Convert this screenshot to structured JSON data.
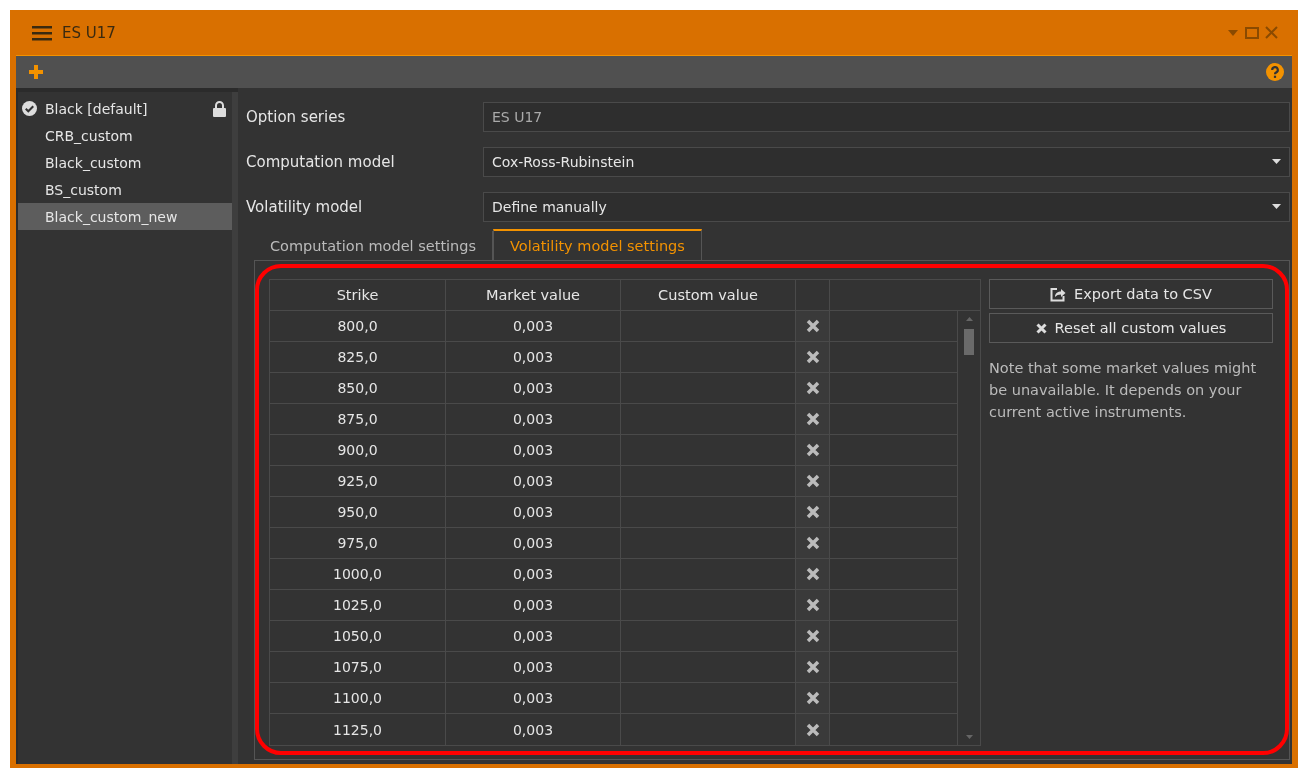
{
  "window": {
    "title": "ES U17"
  },
  "sidebar": {
    "items": [
      {
        "label": "Black [default]",
        "kind": "default",
        "selected": false
      },
      {
        "label": "CRB_custom",
        "kind": "custom",
        "selected": false
      },
      {
        "label": "Black_custom",
        "kind": "custom",
        "selected": false
      },
      {
        "label": "BS_custom",
        "kind": "custom",
        "selected": false
      },
      {
        "label": "Black_custom_new",
        "kind": "custom",
        "selected": true
      }
    ]
  },
  "form": [
    {
      "label": "Option series",
      "kind": "text",
      "value": "ES U17"
    },
    {
      "label": "Computation model",
      "kind": "dropdown",
      "value": "Cox-Ross-Rubinstein"
    },
    {
      "label": "Volatility model",
      "kind": "dropdown",
      "value": "Define manually"
    }
  ],
  "tabs": [
    {
      "label": "Computation model settings",
      "selected": false
    },
    {
      "label": "Volatility model settings",
      "selected": true
    }
  ],
  "table": {
    "columns": [
      "Strike",
      "Market value",
      "Custom value"
    ],
    "rows": [
      {
        "strike": "800,0",
        "market_value": "0,003"
      },
      {
        "strike": "825,0",
        "market_value": "0,003"
      },
      {
        "strike": "850,0",
        "market_value": "0,003"
      },
      {
        "strike": "875,0",
        "market_value": "0,003"
      },
      {
        "strike": "900,0",
        "market_value": "0,003"
      },
      {
        "strike": "925,0",
        "market_value": "0,003"
      },
      {
        "strike": "950,0",
        "market_value": "0,003"
      },
      {
        "strike": "975,0",
        "market_value": "0,003"
      },
      {
        "strike": "1000,0",
        "market_value": "0,003"
      },
      {
        "strike": "1025,0",
        "market_value": "0,003"
      },
      {
        "strike": "1050,0",
        "market_value": "0,003"
      },
      {
        "strike": "1075,0",
        "market_value": "0,003"
      },
      {
        "strike": "1100,0",
        "market_value": "0,003"
      },
      {
        "strike": "1125,0",
        "market_value": "0,003"
      }
    ]
  },
  "actions": [
    {
      "label": "Export data to CSV",
      "kind": "export"
    },
    {
      "label": "Reset all custom values",
      "kind": "reset"
    }
  ],
  "note": "Note that some market values might be unavailable. It depends on your current active instruments."
}
